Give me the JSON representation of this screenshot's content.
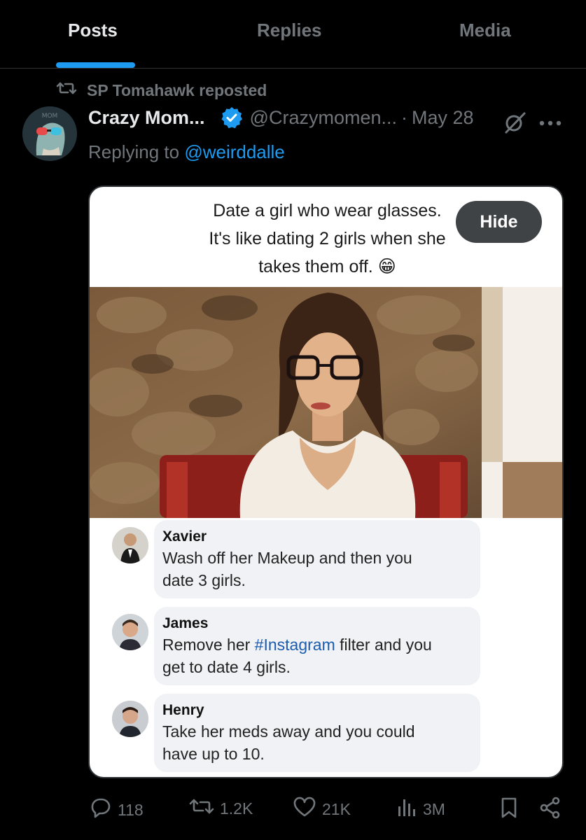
{
  "tabs": [
    {
      "label": "Posts",
      "active": true
    },
    {
      "label": "Replies",
      "active": false
    },
    {
      "label": "Media",
      "active": false
    }
  ],
  "repost": {
    "text": "SP Tomahawk reposted",
    "icon": "repost-icon"
  },
  "post": {
    "author_name": "Crazy Mom...",
    "verified": true,
    "handle": "@Crazymomen...",
    "separator": "·",
    "date": "May 28",
    "replying_prefix": "Replying to ",
    "replying_to": "@weirddalle"
  },
  "media": {
    "caption_lines": [
      "Date a girl who wear glasses.",
      "It's like dating 2 girls when she",
      "takes them off. 😁"
    ],
    "hide_label": "Hide",
    "comments": [
      {
        "name": "Xavier",
        "text_before": "Wash off her Makeup and then you",
        "text_after": "date 3 girls."
      },
      {
        "name": "James",
        "text_before": "Remove her ",
        "hashtag": "#Instagram",
        "text_mid": " filter and you",
        "text_after": "get to date 4 girls."
      },
      {
        "name": "Henry",
        "text_before": "Take her meds away and you could",
        "text_after": "have up to 10."
      }
    ]
  },
  "actions": {
    "replies": "118",
    "reposts": "1.2K",
    "likes": "21K",
    "views": "3M"
  },
  "colors": {
    "accent": "#1d9bf0",
    "muted": "#71767b",
    "background": "#000000",
    "text": "#e7e9ea"
  }
}
